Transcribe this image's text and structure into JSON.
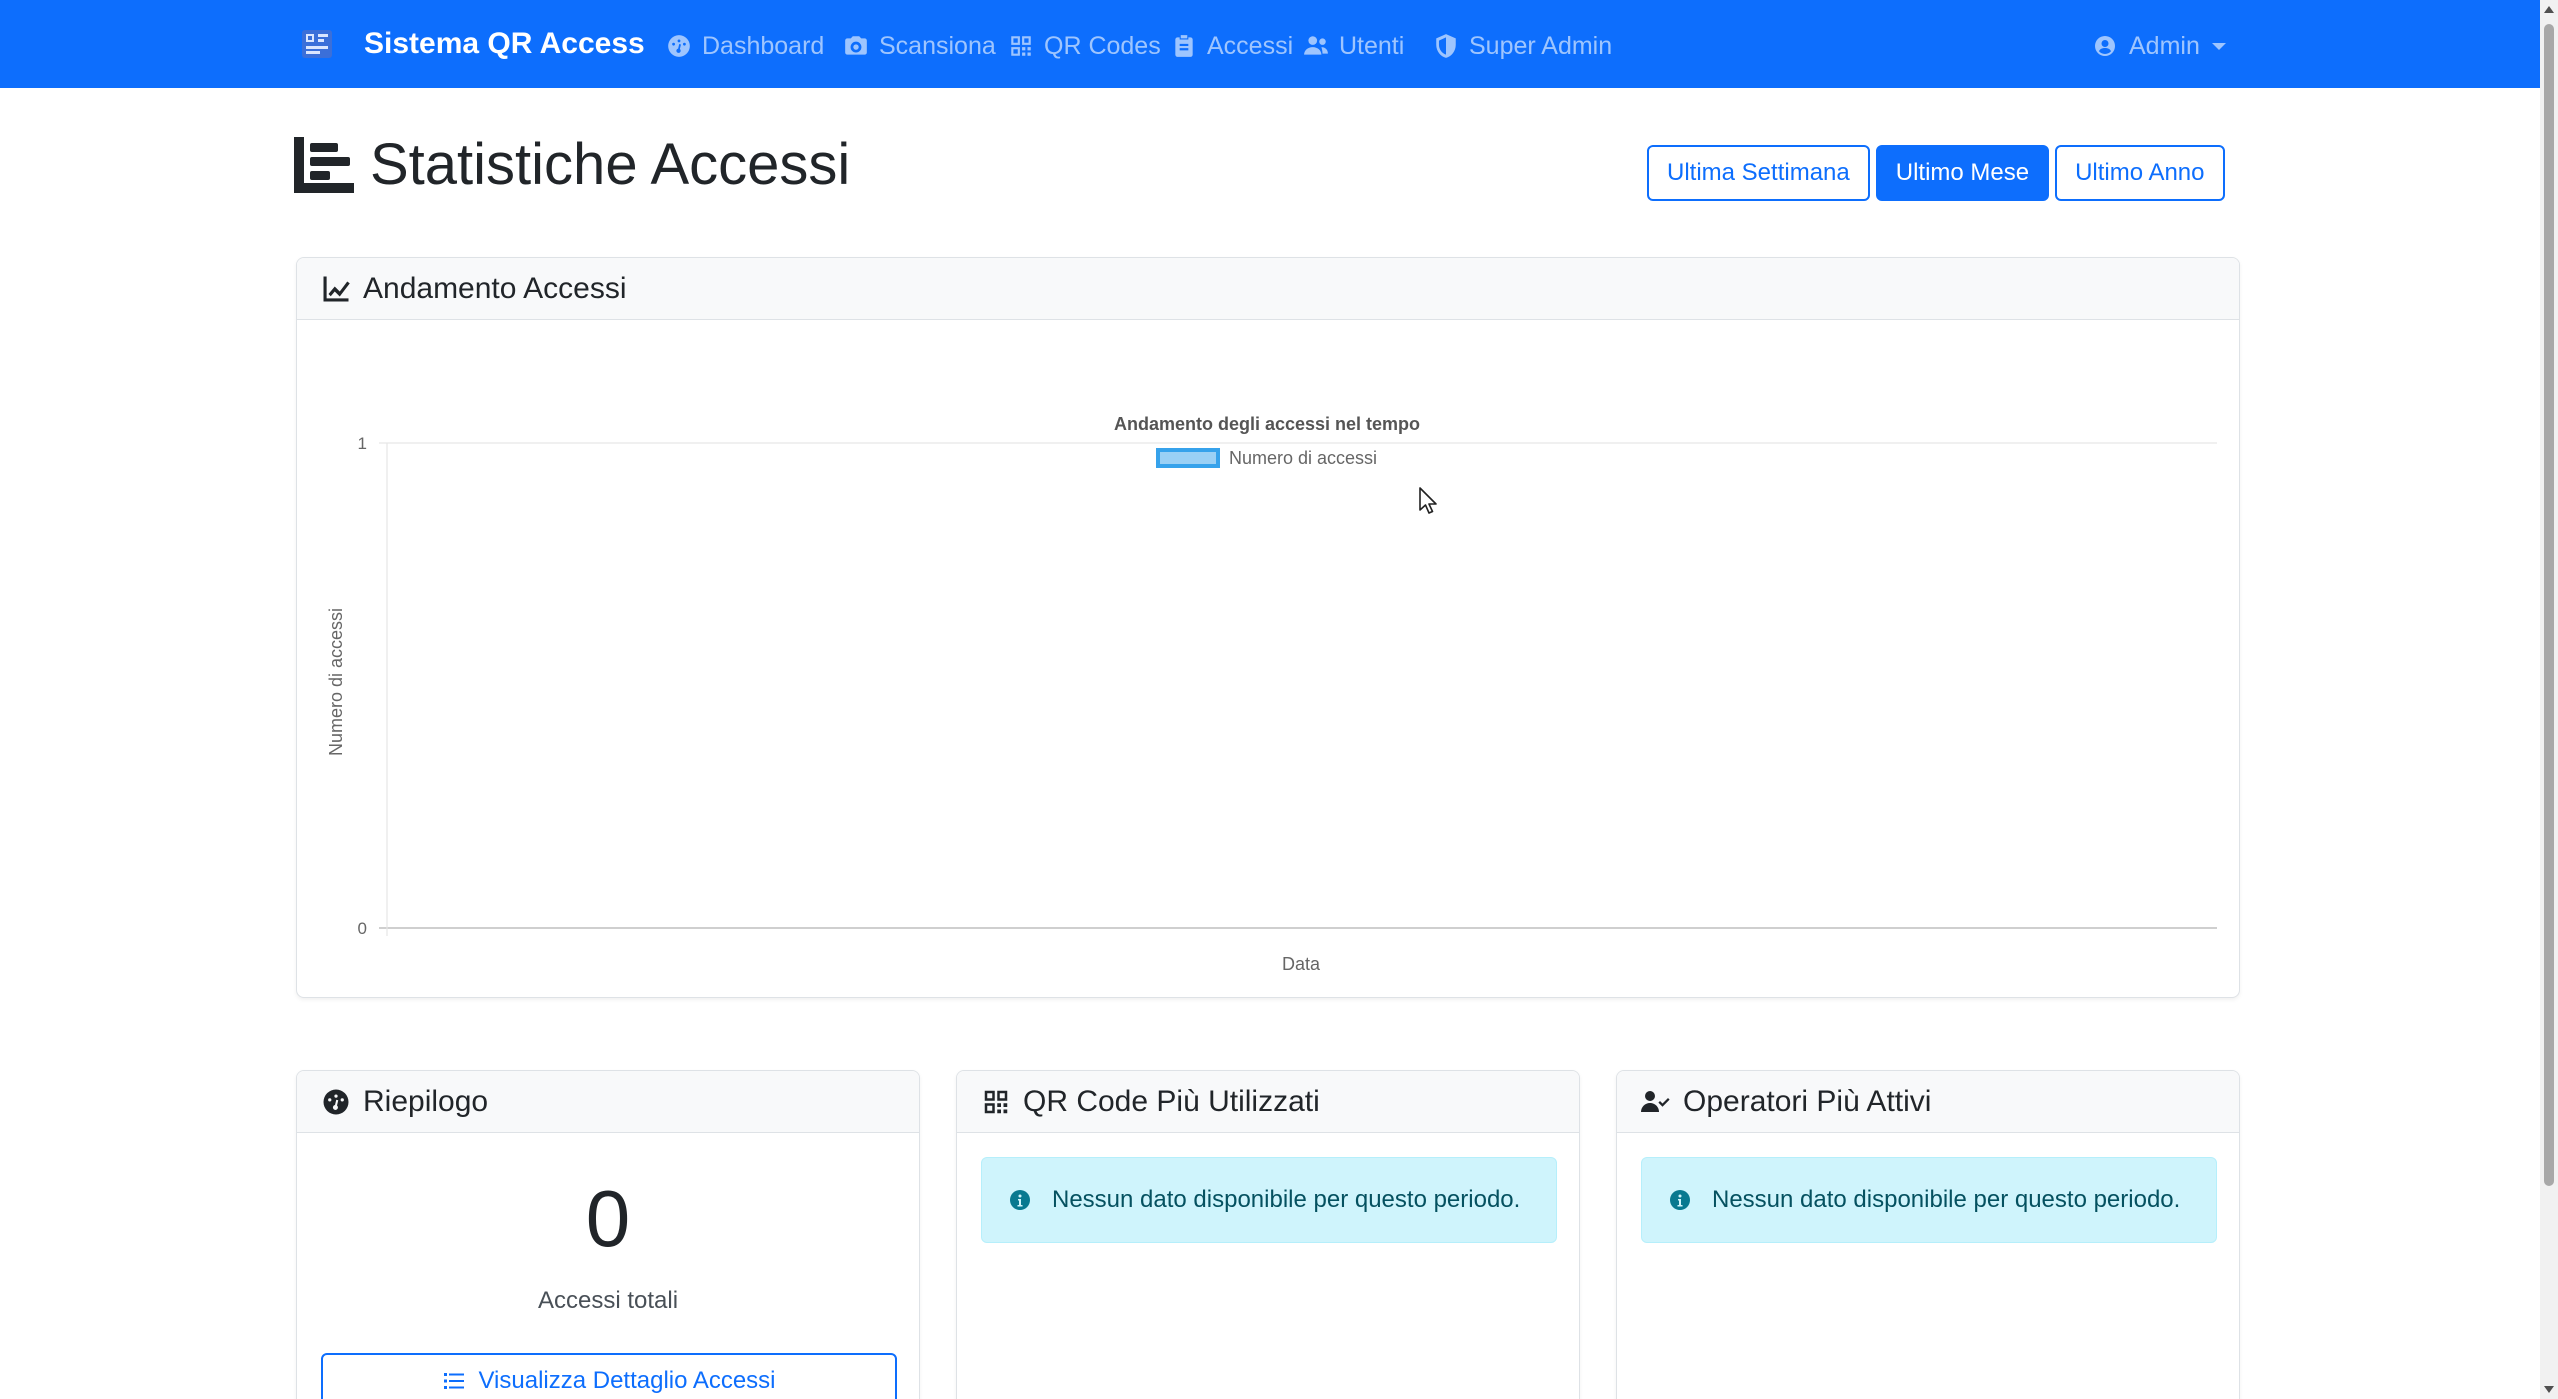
{
  "navbar": {
    "brand": "Sistema QR Access",
    "items": [
      {
        "label": "Dashboard",
        "icon": "gauge-icon"
      },
      {
        "label": "Scansiona",
        "icon": "camera-icon"
      },
      {
        "label": "QR Codes",
        "icon": "qrcode-icon"
      },
      {
        "label": "Accessi",
        "icon": "clipboard-icon"
      },
      {
        "label": "Utenti",
        "icon": "users-icon"
      },
      {
        "label": "Super Admin",
        "icon": "shield-icon"
      }
    ],
    "user": "Admin"
  },
  "header": {
    "title": "Statistiche Accessi",
    "ranges": [
      {
        "label": "Ultima Settimana",
        "active": false
      },
      {
        "label": "Ultimo Mese",
        "active": true
      },
      {
        "label": "Ultimo Anno",
        "active": false
      }
    ]
  },
  "chart_card": {
    "title": "Andamento Accessi"
  },
  "chart_data": {
    "type": "line",
    "title": "Andamento degli accessi nel tempo",
    "xlabel": "Data",
    "ylabel": "Numero di accessi",
    "categories": [],
    "series": [
      {
        "name": "Numero di accessi",
        "values": []
      }
    ],
    "ylim": [
      0,
      1
    ],
    "yticks": [
      "0",
      "1"
    ],
    "legend_position": "top",
    "grid": true,
    "series_color": "#36a2eb"
  },
  "summary": {
    "title": "Riepilogo",
    "total": "0",
    "total_label": "Accessi totali",
    "detail_button": "Visualizza Dettaglio Accessi"
  },
  "qr_card": {
    "title": "QR Code Più Utilizzati",
    "empty_message": "Nessun dato disponibile per questo periodo."
  },
  "ops_card": {
    "title": "Operatori Più Attivi",
    "empty_message": "Nessun dato disponibile per questo periodo."
  },
  "colors": {
    "primary": "#0d6efd",
    "info_bg": "#cff4fc",
    "info_text": "#055160"
  }
}
